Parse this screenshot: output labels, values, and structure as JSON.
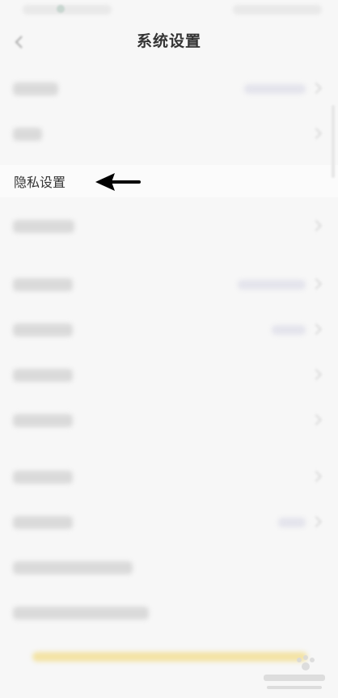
{
  "header": {
    "title": "系统设置"
  },
  "settings": {
    "privacy_label": "隐私设置"
  },
  "colors": {
    "background": "#f7f7f7",
    "title": "#333333",
    "arrow": "#000000",
    "bottom_bar": "#f3e3a5"
  },
  "icons": {
    "back": "back-arrow-icon",
    "pointer": "left-arrow-annotation-icon",
    "row_chevron": "chevron-right-icon"
  }
}
